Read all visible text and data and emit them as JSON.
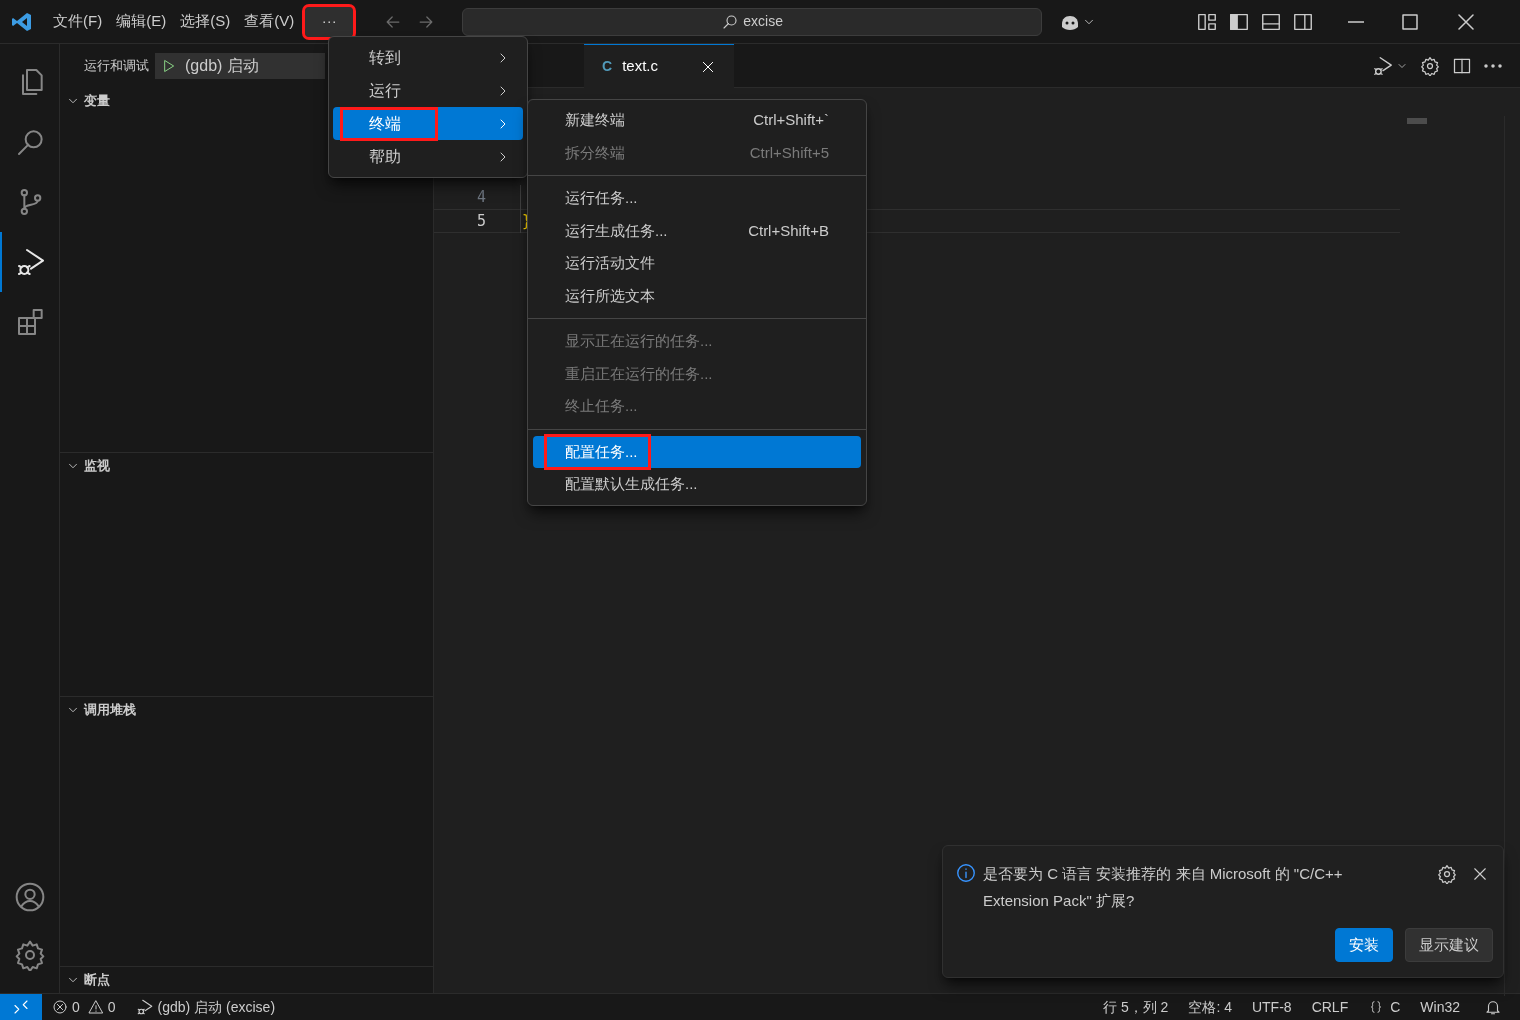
{
  "title_bar": {
    "menus": [
      "文件(F)",
      "编辑(E)",
      "选择(S)",
      "查看(V)"
    ],
    "more_button": {
      "label": "···",
      "annotated": true
    },
    "search": {
      "value": "excise"
    }
  },
  "activity_bar": {
    "items": [
      {
        "kind": "files",
        "selected": false
      },
      {
        "kind": "search",
        "selected": false
      },
      {
        "kind": "source-control",
        "selected": false
      },
      {
        "kind": "run-debug",
        "selected": true
      },
      {
        "kind": "extensions",
        "selected": false
      }
    ]
  },
  "sidebar": {
    "title": "运行和调试",
    "config": "(gdb) 启动",
    "sections": [
      {
        "label": "变量",
        "expanded": true
      },
      {
        "label": "监视",
        "expanded": true
      },
      {
        "label": "调用堆栈",
        "expanded": true
      },
      {
        "label": "断点",
        "expanded": true
      }
    ]
  },
  "tabs": [
    {
      "icon": "C",
      "label": "text.c",
      "selected": true
    }
  ],
  "editor": {
    "lines": [
      {
        "number": "4",
        "current": false
      },
      {
        "number": "5",
        "code": "}",
        "current": true
      }
    ]
  },
  "menu": {
    "items": [
      {
        "label": "转到",
        "selected": false,
        "annotated": false
      },
      {
        "label": "运行",
        "selected": false,
        "annotated": false
      },
      {
        "label": "终端",
        "selected": true,
        "annotated": true
      },
      {
        "label": "帮助",
        "selected": false,
        "annotated": false
      }
    ]
  },
  "submenu": {
    "groups": [
      [
        {
          "label": "新建终端",
          "shortcut": "Ctrl+Shift+`",
          "disabled": false,
          "selected": false,
          "annotated": false
        },
        {
          "label": "拆分终端",
          "shortcut": "Ctrl+Shift+5",
          "disabled": true,
          "selected": false,
          "annotated": false
        }
      ],
      [
        {
          "label": "运行任务...",
          "disabled": false,
          "selected": false,
          "annotated": false
        },
        {
          "label": "运行生成任务...",
          "shortcut": "Ctrl+Shift+B",
          "disabled": false,
          "selected": false,
          "annotated": false
        },
        {
          "label": "运行活动文件",
          "disabled": false,
          "selected": false,
          "annotated": false
        },
        {
          "label": "运行所选文本",
          "disabled": false,
          "selected": false,
          "annotated": false
        }
      ],
      [
        {
          "label": "显示正在运行的任务...",
          "disabled": true,
          "selected": false,
          "annotated": false
        },
        {
          "label": "重启正在运行的任务...",
          "disabled": true,
          "selected": false,
          "annotated": false
        },
        {
          "label": "终止任务...",
          "disabled": true,
          "selected": false,
          "annotated": false
        }
      ],
      [
        {
          "label": "配置任务...",
          "disabled": false,
          "selected": true,
          "annotated": true
        },
        {
          "label": "配置默认生成任务...",
          "disabled": false,
          "selected": false,
          "annotated": false
        }
      ]
    ]
  },
  "notification": {
    "message": "是否要为 C 语言 安装推荐的 来自 Microsoft 的 \"C/C++ Extension Pack\" 扩展?",
    "buttons": [
      {
        "label": "安装",
        "kind": "primary"
      },
      {
        "label": "显示建议",
        "kind": "secondary"
      }
    ]
  },
  "status_bar": {
    "errors": "0",
    "warnings": "0",
    "debug": "(gdb) 启动 (excise)",
    "items": [
      {
        "kind": "text",
        "label": "行 5，列 2"
      },
      {
        "kind": "text",
        "label": "空格: 4"
      },
      {
        "kind": "text",
        "label": "UTF-8"
      },
      {
        "kind": "text",
        "label": "CRLF"
      },
      {
        "kind": "language",
        "label": "C"
      },
      {
        "kind": "text",
        "label": "Win32"
      }
    ]
  }
}
